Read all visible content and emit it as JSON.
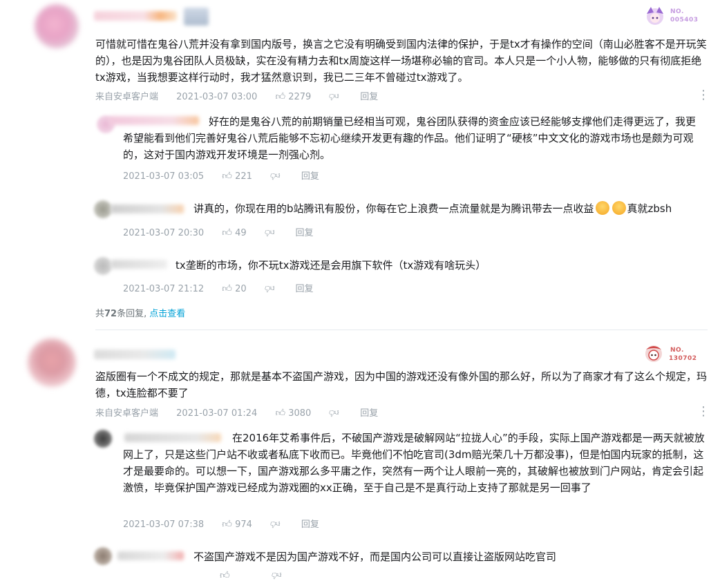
{
  "thread1": {
    "main": {
      "text": "可惜就可惜在鬼谷八荒并没有拿到国内版号，换言之它没有明确受到国内法律的保护，于是tx才有操作的空间（南山必胜客不是开玩笑的），也是因为鬼谷团队人员极缺，实在没有精力去和tx周旋这样一场堪称必输的官司。本人只是一个小人物，能够做的只有彻底拒绝tx游戏，当我想要这样行动时，我才猛然意识到，我已二三年不曾碰过tx游戏了。",
      "source": "来自安卓客户端",
      "time": "2021-03-07 03:00",
      "likes": "2279",
      "reply_label": "回复",
      "badge_no": "NO.",
      "badge_num": "005403"
    },
    "replies": [
      {
        "text": "好在的是鬼谷八荒的前期销量已经相当可观，鬼谷团队获得的资金应该已经能够支撑他们走得更远了，我更希望能看到他们完善好鬼谷八荒后能够不忘初心继续开发更有趣的作品。他们证明了“硬核”中文文化的游戏市场也是颇为可观的，这对于国内游戏开发环境是一剂强心剂。",
        "time": "2021-03-07 03:05",
        "likes": "221",
        "reply_label": "回复"
      },
      {
        "text": "讲真的，你现在用的b站腾讯有股份，你每在它上浪费一点流量就是为腾讯带去一点收益",
        "tail": "真就zbsh",
        "time": "2021-03-07 20:30",
        "likes": "49",
        "reply_label": "回复"
      },
      {
        "text": "tx垄断的市场，你不玩tx游戏还是会用旗下软件（tx游戏有啥玩头）",
        "time": "2021-03-07 21:12",
        "likes": "20",
        "reply_label": "回复"
      }
    ],
    "reply_count_prefix": "共",
    "reply_count": "72",
    "reply_count_suffix": "条回复,",
    "view_link": "点击查看"
  },
  "thread2": {
    "main": {
      "text": "盗版圈有一个不成文的规定，那就是基本不盗国产游戏，因为中国的游戏还没有像外国的那么好，所以为了商家才有了这么个规定，玛德，tx连脸都不要了",
      "source": "来自安卓客户端",
      "time": "2021-03-07 01:24",
      "likes": "3080",
      "reply_label": "回复",
      "badge_no": "NO.",
      "badge_num": "130702"
    },
    "replies": [
      {
        "text": "在2016年艾希事件后，不破国产游戏是破解网站“拉拢人心”的手段，实际上国产游戏都是一两天就被放网上了，只是这些门户站不收或者私底下收而已。毕竟他们不怕吃官司(3dm赔光荣几十万都没事)，但是怕国内玩家的抵制，这才是最要命的。可以想一下，国产游戏那么多平庸之作，突然有一两个让人眼前一亮的，其破解也被放到门户网站，肯定会引起激愤，毕竟保护国产游戏已经成为游戏圈的xx正确，至于自己是不是真行动上支持了那就是另一回事了",
        "time": "2021-03-07 07:38",
        "likes": "974",
        "reply_label": "回复"
      },
      {
        "text": "不盗国产游戏不是因为国产游戏不好，而是国内公司可以直接让盗版网站吃官司"
      }
    ]
  },
  "colors": {
    "text": "#18191c",
    "meta": "#99a2aa",
    "link": "#00a1d6",
    "divider": "#e5e9ef"
  },
  "icons": [
    "thumb-up-icon",
    "thumb-down-icon",
    "more-vertical-icon",
    "emoji-icon",
    "fan-badge-icon"
  ]
}
